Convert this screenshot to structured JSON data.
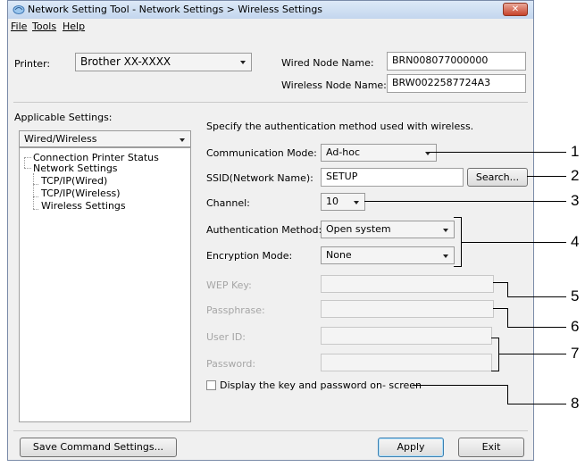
{
  "window": {
    "title": "Network Setting Tool - Network Settings > Wireless Settings",
    "close_symbol": "✕"
  },
  "menu": [
    {
      "label": "File"
    },
    {
      "label": "Tools"
    },
    {
      "label": "Help"
    }
  ],
  "printer": {
    "label": "Printer:",
    "value": "Brother XX-XXXX"
  },
  "wired_node": {
    "label": "Wired Node Name:",
    "value": "BRN008077000000"
  },
  "wireless_node": {
    "label": "Wireless Node Name:",
    "value": "BRW0022587724A3"
  },
  "applicable": {
    "label": "Applicable Settings:",
    "value": "Wired/Wireless"
  },
  "tree": [
    {
      "label": "Connection Printer Status"
    },
    {
      "label": "Network Settings"
    },
    {
      "label": "TCP/IP(Wired)"
    },
    {
      "label": "TCP/IP(Wireless)"
    },
    {
      "label": "Wireless Settings"
    }
  ],
  "instructions": "Specify the authentication method used with wireless.",
  "form": {
    "communication_mode": {
      "label": "Communication Mode:",
      "value": "Ad-hoc"
    },
    "ssid": {
      "label": "SSID(Network Name):",
      "value": "SETUP",
      "button": "Search..."
    },
    "channel": {
      "label": "Channel:",
      "value": "10"
    },
    "auth_method": {
      "label": "Authentication Method:",
      "value": "Open system"
    },
    "encryption_mode": {
      "label": "Encryption Mode:",
      "value": "None"
    },
    "wep_key": {
      "label": "WEP Key:",
      "value": ""
    },
    "passphrase": {
      "label": "Passphrase:",
      "value": ""
    },
    "user_id": {
      "label": "User ID:",
      "value": ""
    },
    "password": {
      "label": "Password:",
      "value": ""
    },
    "display_key": {
      "label": "Display the key and password on- screen",
      "checked": false
    }
  },
  "buttons": {
    "save": "Save Command Settings...",
    "apply": "Apply",
    "exit": "Exit"
  },
  "callouts": [
    "1",
    "2",
    "3",
    "4",
    "5",
    "6",
    "7",
    "8"
  ]
}
